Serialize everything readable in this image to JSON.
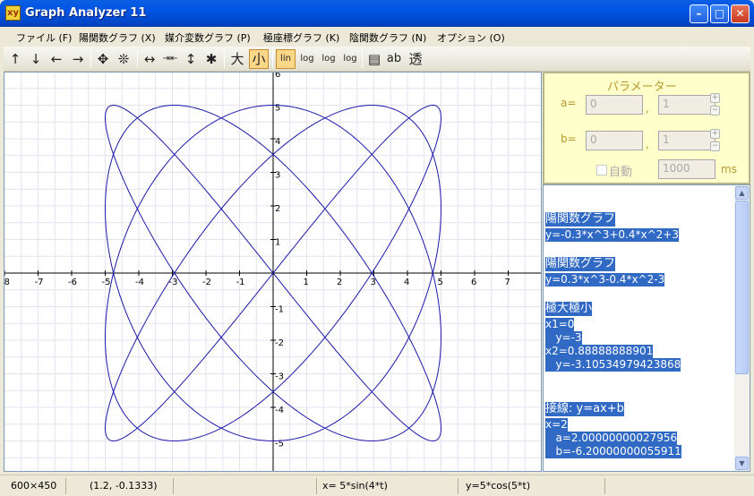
{
  "window": {
    "title": "Graph Analyzer 11",
    "icon_text": "xy"
  },
  "menu": [
    {
      "label": "ファイル (F)"
    },
    {
      "label": "陽関数グラフ (X)"
    },
    {
      "label": "媒介変数グラフ (P)"
    },
    {
      "label": "極座標グラフ (K)"
    },
    {
      "label": "陰関数グラフ (N)"
    },
    {
      "label": "オプション (O)"
    }
  ],
  "toolbar": {
    "buttons": [
      {
        "icon": "arrow-up-icon",
        "glyph": "↑"
      },
      {
        "icon": "arrow-down-icon",
        "glyph": "↓"
      },
      {
        "icon": "arrow-left-icon",
        "glyph": "←"
      },
      {
        "icon": "arrow-right-icon",
        "glyph": "→"
      },
      {
        "icon": "move-icon",
        "glyph": "✥"
      },
      {
        "icon": "center-icon",
        "glyph": "❊"
      },
      {
        "icon": "stretch-horizontal-icon",
        "glyph": "↔"
      },
      {
        "icon": "shrink-horizontal-icon",
        "glyph": "⇥⇤"
      },
      {
        "icon": "stretch-vertical-icon",
        "glyph": "↕"
      },
      {
        "icon": "shrink-vertical-icon",
        "glyph": "✱"
      },
      {
        "icon": "zoom-large-icon",
        "glyph": "大"
      },
      {
        "icon": "zoom-small-icon",
        "glyph": "小"
      },
      {
        "icon": "linear-scale-icon",
        "glyph": "lin"
      },
      {
        "icon": "log-x-icon",
        "glyph": "log"
      },
      {
        "icon": "log-y-icon",
        "glyph": "log"
      },
      {
        "icon": "log-xy-icon",
        "glyph": "log"
      },
      {
        "icon": "notes-icon",
        "glyph": "▤"
      },
      {
        "icon": "label-icon",
        "glyph": "ab"
      },
      {
        "icon": "transparent-icon",
        "glyph": "透"
      }
    ]
  },
  "params": {
    "title": "パラメーター",
    "a_label": "a=",
    "b_label": "b=",
    "a_value_1": "0",
    "a_value_2": "1",
    "b_value_1": "0",
    "b_value_2": "1",
    "separator": ",",
    "auto_label": "自動",
    "interval_value": "1000",
    "interval_unit": "ms"
  },
  "output_lines": [
    {
      "text": "陽関数グラフ",
      "style": "big"
    },
    {
      "text": "y=-0.3*x^3+0.4*x^2+3",
      "style": "sm"
    },
    {
      "text": "",
      "style": "gap"
    },
    {
      "text": "陽関数グラフ",
      "style": "big"
    },
    {
      "text": "y=0.3*x^3-0.4*x^2-3",
      "style": "sm"
    },
    {
      "text": "",
      "style": "gap"
    },
    {
      "text": "極大極小",
      "style": "big"
    },
    {
      "text": "x1=0",
      "style": "sm"
    },
    {
      "text": "   y=-3",
      "style": "sm"
    },
    {
      "text": "x2=0.88888888901",
      "style": "sm"
    },
    {
      "text": "   y=-3.10534979423868",
      "style": "sm"
    },
    {
      "text": "",
      "style": "gap"
    },
    {
      "text": "",
      "style": "gap"
    },
    {
      "text": "接線: y=ax+b",
      "style": "big"
    },
    {
      "text": "x=2",
      "style": "sm"
    },
    {
      "text": "   a=2.00000000027956",
      "style": "sm"
    },
    {
      "text": "   b=-6.20000000055911",
      "style": "sm"
    }
  ],
  "status": {
    "size": "600×450",
    "cursor": "(1.2, -0.1333)",
    "x_formula": "x= 5*sin(4*t)",
    "y_formula": "y=5*cos(5*t)"
  },
  "chart_data": {
    "type": "line",
    "curve": {
      "kind": "parametric",
      "x_expr": "5*sin(4*t)",
      "y_expr": "5*cos(5*t)",
      "t_range": [
        0,
        6.2832
      ]
    },
    "color": "#1a1aa8",
    "xlim": [
      -8,
      8
    ],
    "ylim": [
      -6,
      6
    ],
    "x_ticks": [
      -8,
      -7,
      -6,
      -5,
      -4,
      -3,
      -2,
      -1,
      1,
      2,
      3,
      4,
      5,
      6,
      7
    ],
    "y_ticks": [
      6,
      5,
      4,
      3,
      2,
      1,
      -1,
      -2,
      -3,
      -4,
      -5
    ],
    "grid": true
  }
}
